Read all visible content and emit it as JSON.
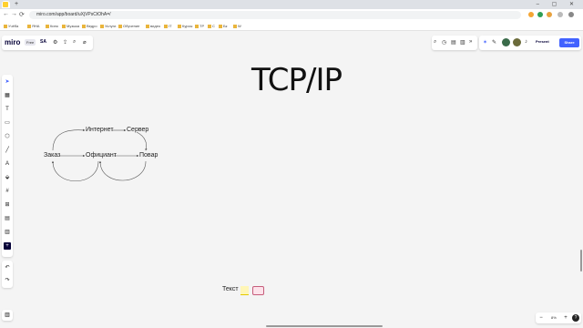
{
  "browser": {
    "url": "miro.com/app/board/uXjVPsCtOhA=/",
    "new_tab": "+",
    "tab_close": "×",
    "window_controls": "– ▢ ✕",
    "nav": [
      "←",
      "→",
      "⟳"
    ],
    "bookmarks": [
      "Учёба",
      "ЯНА",
      "Кино",
      "Музыка",
      "Ведро",
      "Услуги",
      "Обучение",
      "видео",
      "IT",
      "Курсы",
      "TP",
      "С",
      "Бк",
      "W"
    ]
  },
  "miro": {
    "logo": "miro",
    "plan_badge": "Free",
    "board_name": "SA",
    "top_icons": [
      "⚙",
      "⇪",
      "⌕",
      "⌀"
    ],
    "collab_icons": [
      "⌕",
      "◷",
      "▤",
      "▥",
      "»"
    ],
    "present_label": "Present",
    "share_label": "Share",
    "tools": [
      "➤",
      "▦",
      "T",
      "▭",
      "⬡",
      "╱",
      "A",
      "⬙",
      "#",
      "⊞",
      "▤",
      "▥",
      "+"
    ],
    "undo": "↶",
    "redo": "↷",
    "panel_icon": "▥",
    "zoom_level": "8%",
    "zoom_minus": "−",
    "zoom_plus": "+",
    "help": "?"
  },
  "board": {
    "title": "TCP/IP",
    "nodes": {
      "internet": "Интернет",
      "server": "Сервер",
      "order": "Заказ",
      "waiter": "Официант",
      "cook": "Повар"
    },
    "legend_text": "Текст"
  },
  "colors": {
    "accent": "#4262ff",
    "sticky": "#fff6b6",
    "shape_fill": "#fde2ea",
    "shape_border": "#c65d7b"
  }
}
